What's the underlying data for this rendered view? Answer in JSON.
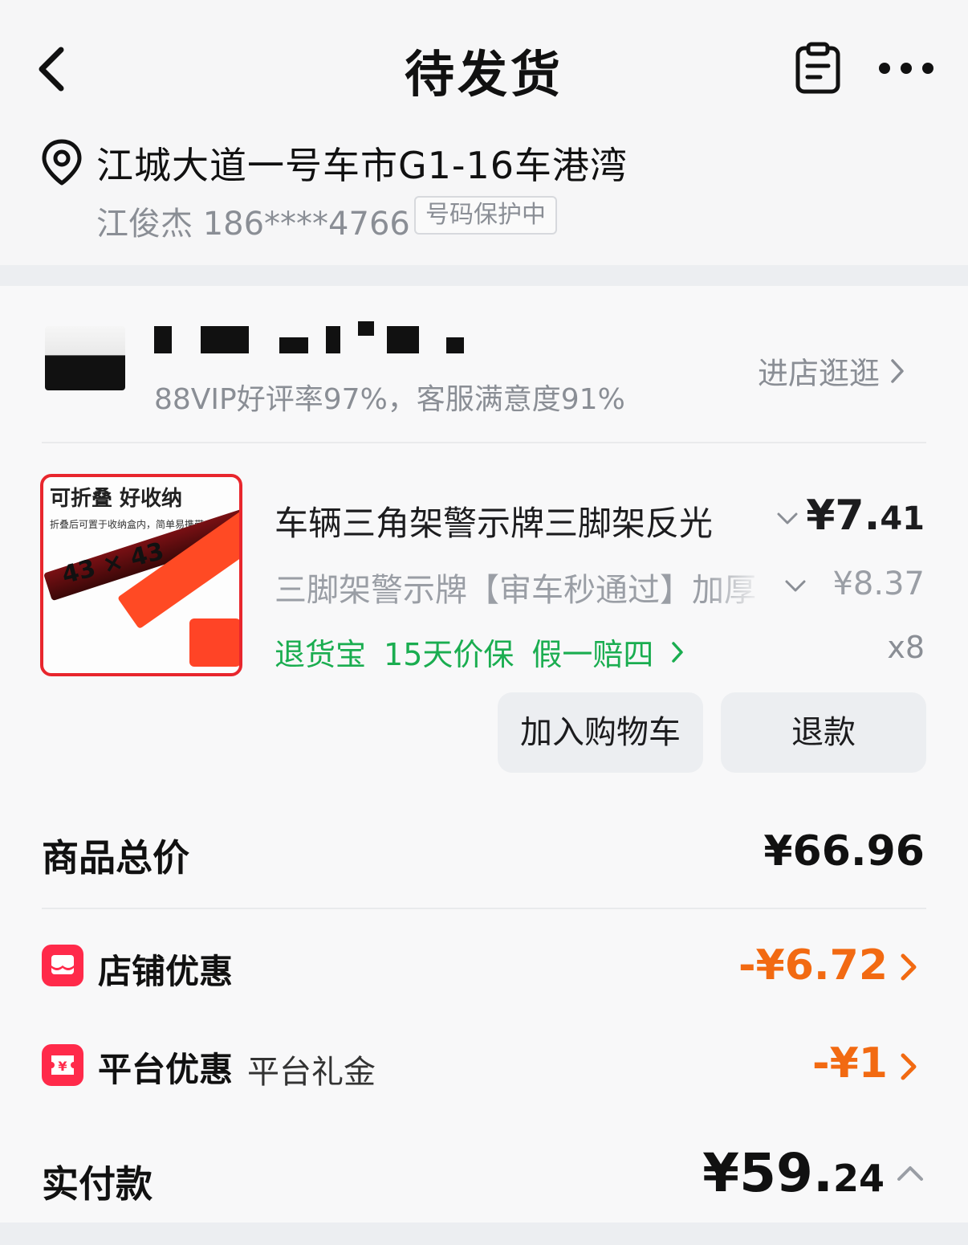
{
  "header": {
    "title": "待发货"
  },
  "address": {
    "line": "江城大道一号车市G1-16车港湾",
    "contact": "江俊杰 186****4766",
    "protect_badge": "号码保护中"
  },
  "store": {
    "rating": "88VIP好评率97%，客服满意度91%",
    "visit_label": "进店逛逛"
  },
  "product": {
    "image_caption": "可折叠 好收纳",
    "image_sub": "折叠后可置于收纳盒内，简单易携带",
    "image_dimension": "43 × 43",
    "title": "车辆三角架警示牌三脚架反光",
    "spec": "三脚架警示牌【审车秒通过】加厚",
    "price_int": "¥7.",
    "price_dec": "41",
    "original_price": "¥8.37",
    "services": [
      "退货宝",
      "15天价保",
      "假一赔四"
    ],
    "quantity": "x8",
    "add_cart_label": "加入购物车",
    "refund_label": "退款"
  },
  "summary": {
    "total_label": "商品总价",
    "total_value": "¥66.96",
    "store_discount_label": "店铺优惠",
    "store_discount_value": "-¥6.72",
    "platform_discount_label": "平台优惠",
    "platform_discount_sub": "平台礼金",
    "platform_discount_value": "-¥1",
    "paid_label": "实付款",
    "paid_int": "¥59.",
    "paid_dec": "24"
  },
  "colors": {
    "accent_orange": "#f26a12",
    "service_green": "#1aad50",
    "coupon_red": "#ff2a4a"
  },
  "icons": [
    "back-icon",
    "clipboard-icon",
    "more-icon",
    "location-pin-icon",
    "chevron-right-icon",
    "chevron-down-icon",
    "shop-coupon-icon",
    "platform-coupon-icon",
    "chevron-up-icon"
  ]
}
